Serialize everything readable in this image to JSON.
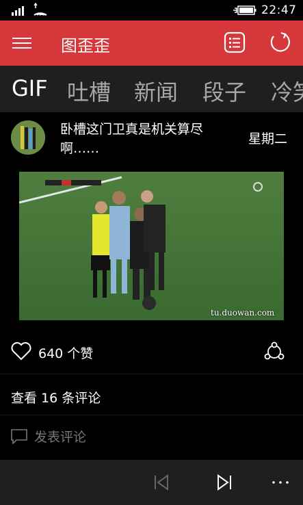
{
  "status_bar": {
    "time": "22:47",
    "icons": [
      "signal-icon",
      "wifi-icon",
      "battery-charging-icon"
    ]
  },
  "app_bar": {
    "title": "图歪歪",
    "icons": [
      "hamburger-menu-icon",
      "list-icon",
      "refresh-icon"
    ],
    "background_color": "#d5373a"
  },
  "tabs": [
    {
      "label": "GIF",
      "active": true
    },
    {
      "label": "吐槽",
      "active": false
    },
    {
      "label": "新闻",
      "active": false
    },
    {
      "label": "段子",
      "active": false
    },
    {
      "label": "冷笑",
      "active": false
    }
  ],
  "post": {
    "title": "卧槽这门卫真是机关算尽啊……",
    "day": "星期二",
    "watermark": "tu.duowan.com",
    "likes": "640 个赞",
    "view_comments": "查看 16 条评论",
    "comment_placeholder": "发表评论"
  },
  "bottom_bar": {
    "icons": [
      "previous-icon",
      "next-icon",
      "more-icon"
    ]
  }
}
